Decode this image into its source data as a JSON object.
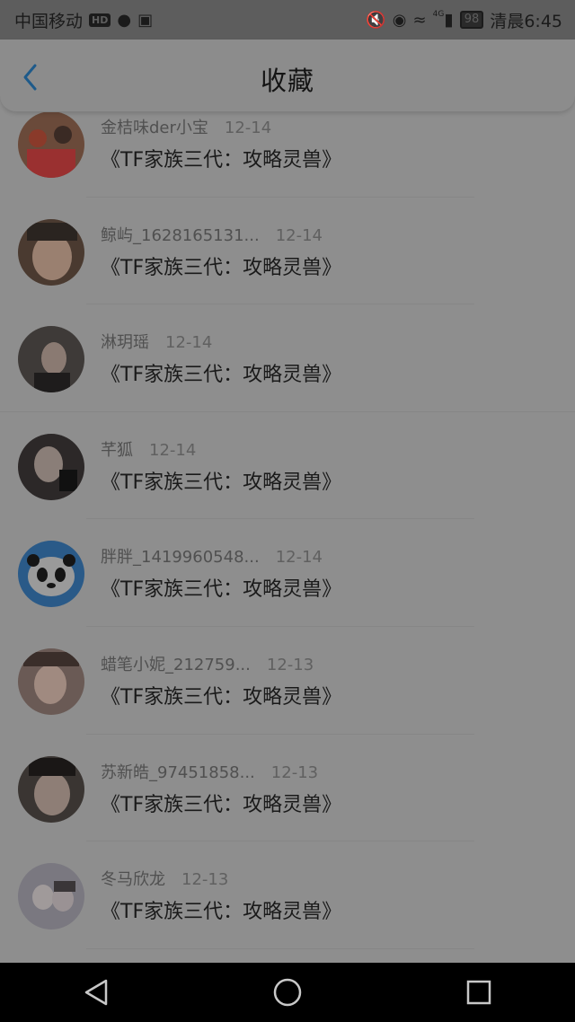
{
  "status_bar": {
    "carrier": "中国移动",
    "hd": "HD",
    "network": "4G",
    "battery": "98",
    "time": "清晨6:45"
  },
  "header": {
    "title": "收藏"
  },
  "items": [
    {
      "name": "金桔味der小宝",
      "date": "12-14",
      "title": "《TF家族三代：攻略灵兽》",
      "avatar_color": "#6a4a3a"
    },
    {
      "name": "鲸屿_1628165131...",
      "date": "12-14",
      "title": "《TF家族三代：攻略灵兽》",
      "avatar_color": "#4a3a30"
    },
    {
      "name": "淋玥瑶",
      "date": "12-14",
      "title": "《TF家族三代：攻略灵兽》",
      "avatar_color": "#3e3a38"
    },
    {
      "name": "芊狐",
      "date": "12-14",
      "title": "《TF家族三代：攻略灵兽》",
      "avatar_color": "#2c2828"
    },
    {
      "name": "胖胖_1419960548...",
      "date": "12-14",
      "title": "《TF家族三代：攻略灵兽》",
      "avatar_color": "#2a5a88"
    },
    {
      "name": "蜡笔小妮_212759...",
      "date": "12-13",
      "title": "《TF家族三代：攻略灵兽》",
      "avatar_color": "#6a5a55"
    },
    {
      "name": "苏新皓_97451858...",
      "date": "12-13",
      "title": "《TF家族三代：攻略灵兽》",
      "avatar_color": "#3a3532"
    },
    {
      "name": "冬马欣龙",
      "date": "12-13",
      "title": "《TF家族三代：攻略灵兽》",
      "avatar_color": "#7a7880"
    }
  ],
  "colors": {
    "accent": "#1e5a8a",
    "overlay": "#8e8e8e"
  }
}
